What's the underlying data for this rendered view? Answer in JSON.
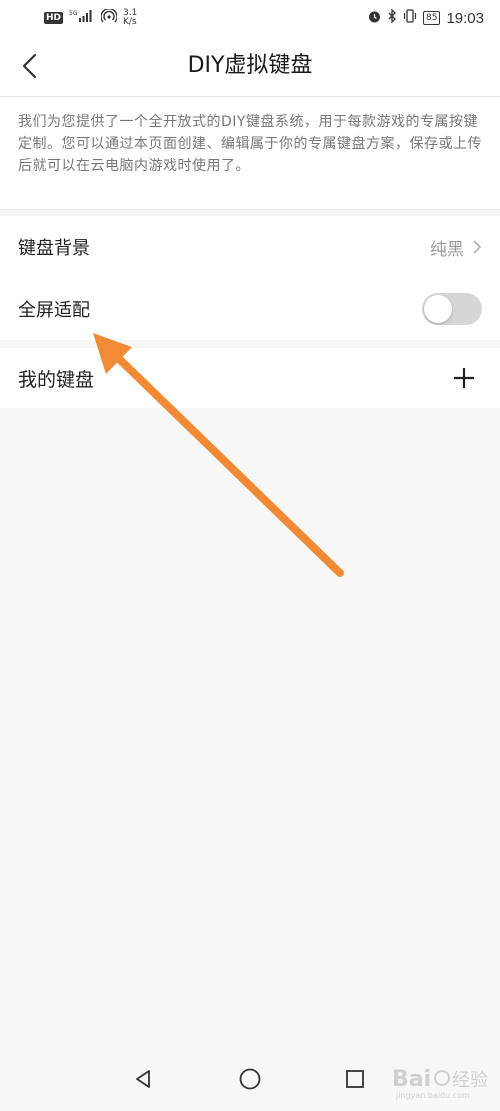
{
  "status_bar": {
    "hd": "HD",
    "signal_label": "5G",
    "net_speed_value": "3.1",
    "net_speed_unit": "K/s",
    "battery": "85",
    "time": "19:03"
  },
  "header": {
    "title": "DIY虚拟键盘",
    "back_icon": "chevron-left-icon"
  },
  "intro": {
    "text": "我们为您提供了一个全开放式的DIY键盘系统，用于每款游戏的专属按键定制。您可以通过本页面创建、编辑属于你的专属键盘方案，保存或上传后就可以在云电脑内游戏时使用了。"
  },
  "settings": {
    "background_label": "键盘背景",
    "background_value": "纯黑",
    "fullscreen_label": "全屏适配",
    "fullscreen_enabled": false
  },
  "my_keyboard": {
    "label": "我的键盘",
    "add_icon": "plus-icon"
  },
  "annotation": {
    "arrow_color": "#f28a35"
  },
  "nav_bar": {
    "back_icon": "triangle-back-icon",
    "home_icon": "circle-home-icon",
    "recents_icon": "square-recents-icon"
  }
}
